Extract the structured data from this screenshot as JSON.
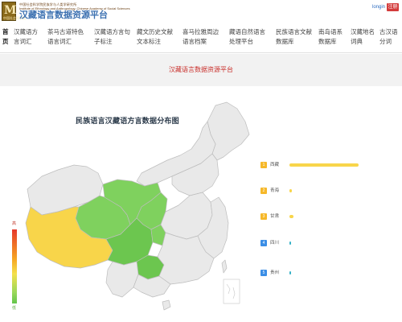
{
  "header": {
    "logo_letter": "M",
    "logo_sub": "中国社会科学院",
    "institute_line": "中国社会科学院民族学与人类学研究所",
    "institute_line_en": "Institute of Ethnology and Anthropology, Chinese Academy of Social Sciences",
    "site_name": "汉藏语言数据资源平台",
    "login": "longin",
    "register": "注册"
  },
  "nav": [
    "首页",
    "汉藏语方言词汇",
    "茶马古道特色语言词汇",
    "汉藏语方言句子标注",
    "藏文历史文献文本标注",
    "喜马拉雅周边语言档案",
    "藏语自然语言处理平台",
    "民族语言文献数据库",
    "南岛语系数据库",
    "汉藏地名词典",
    "古汉语分词"
  ],
  "banner": {
    "title": "汉藏语言数据资源平台"
  },
  "map": {
    "scale_high": "高",
    "scale_low": "低",
    "colors": {
      "high": "#f8d54a",
      "mid": "#7fd15e",
      "low": "#6cc64f",
      "none": "#e9e9e9",
      "border": "#bdbdbd"
    }
  },
  "chart_data": {
    "type": "bar",
    "title": "民族语言汉藏语方言数据分布图",
    "categories": [
      "西藏",
      "青海",
      "甘肃",
      "四川",
      "贵州"
    ],
    "values": [
      100,
      3,
      6,
      1,
      1
    ],
    "rank_colors": [
      "#f6b829",
      "#f6b829",
      "#f6b829",
      "#3a8ee6",
      "#3a8ee6"
    ],
    "bar_colors": [
      "#f8d54a",
      "#f8d54a",
      "#f8d54a",
      "#37b2c8",
      "#37b2c8"
    ]
  }
}
